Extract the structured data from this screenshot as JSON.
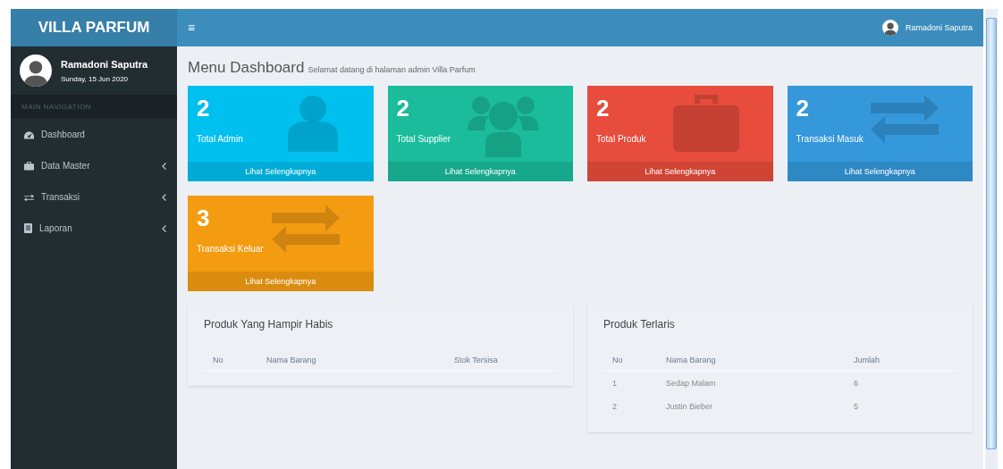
{
  "sidebar": {
    "logo": "VILLA PARFUM",
    "user": {
      "name": "Ramadoni Saputra",
      "date": "Sunday, 15 Jun 2020"
    },
    "section_label": "MAIN NAVIGATION",
    "items": [
      {
        "label": "Dashboard",
        "expandable": false
      },
      {
        "label": "Data Master",
        "expandable": true
      },
      {
        "label": "Transaksi",
        "expandable": true
      },
      {
        "label": "Laporan",
        "expandable": true
      }
    ]
  },
  "header": {
    "menu_icon": "≡",
    "user_name": "Ramadoni Saputra"
  },
  "page": {
    "title": "Menu Dashboard",
    "subtitle": "Selamat datang di halaman admin Villa Parfum"
  },
  "cards": [
    {
      "value": "2",
      "label": "Total Admin",
      "link": "Lihat Selengkapnya",
      "color": "#00c0ef"
    },
    {
      "value": "2",
      "label": "Total Supplier",
      "link": "Lihat Selengkapnya",
      "color": "#1abc9c"
    },
    {
      "value": "2",
      "label": "Total Produk",
      "link": "Lihat Selengkapnya",
      "color": "#e74c3c"
    },
    {
      "value": "2",
      "label": "Transaksi Masuk",
      "link": "Lihat Selengkapnya",
      "color": "#3498db"
    },
    {
      "value": "3",
      "label": "Transaksi Keluar",
      "link": "Lihat Selengkapnya",
      "color": "#f39c12"
    }
  ],
  "tables": [
    {
      "title": "Produk Yang Hampir Habis",
      "columns": [
        "No",
        "Nama Barang",
        "Stok Tersisa"
      ]
    },
    {
      "title": "Produk Terlaris",
      "columns": [
        "No",
        "Nama Barang",
        "Jumlah"
      ],
      "rows": [
        [
          "1",
          "Sedap Malam",
          "6"
        ],
        [
          "2",
          "Justin Bieber",
          "5"
        ]
      ]
    }
  ]
}
